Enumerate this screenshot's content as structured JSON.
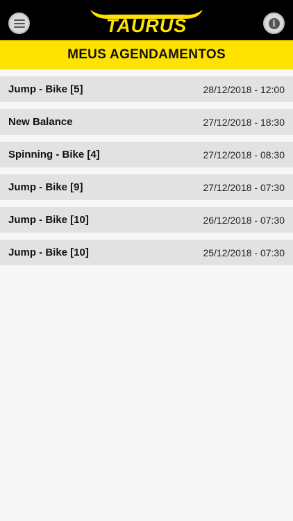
{
  "header": {
    "logo_text": "TAURUS",
    "menu_icon": "hamburger-menu-icon",
    "info_icon": "info-icon",
    "brand_colors": {
      "bar": "#000000",
      "logo": "#ffe300",
      "title_bar": "#ffe300"
    }
  },
  "page": {
    "title": "MEUS AGENDAMENTOS"
  },
  "appointments": [
    {
      "name": "Jump - Bike [5]",
      "datetime": "28/12/2018 - 12:00"
    },
    {
      "name": "New Balance",
      "datetime": "27/12/2018 - 18:30"
    },
    {
      "name": "Spinning - Bike [4]",
      "datetime": "27/12/2018 - 08:30"
    },
    {
      "name": "Jump - Bike [9]",
      "datetime": "27/12/2018 - 07:30"
    },
    {
      "name": "Jump - Bike [10]",
      "datetime": "26/12/2018 - 07:30"
    },
    {
      "name": "Jump - Bike [10]",
      "datetime": "25/12/2018 - 07:30"
    }
  ]
}
